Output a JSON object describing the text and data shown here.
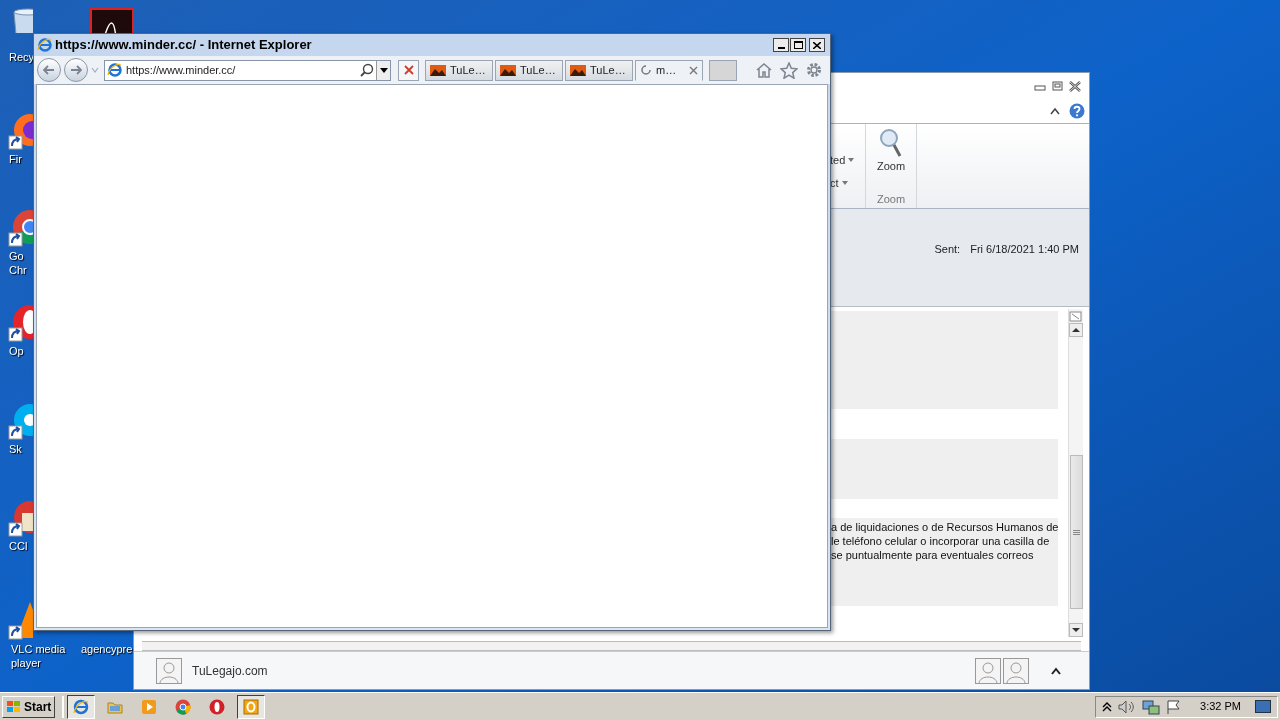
{
  "desktop_icons": [
    {
      "kind": "recycle",
      "lines": [
        "Recy"
      ]
    },
    {
      "kind": "pdf"
    },
    {
      "kind": "firefox",
      "lines": [
        "Fir"
      ]
    },
    {
      "kind": "chrome",
      "lines": [
        "Go",
        "Chr"
      ]
    },
    {
      "kind": "opera",
      "lines": [
        "Op"
      ]
    },
    {
      "kind": "skype",
      "lines": [
        "Sk"
      ]
    },
    {
      "kind": "ccleaner",
      "lines": [
        "CCl"
      ]
    },
    {
      "kind": "vlc",
      "lines": [
        "VLC media",
        "player"
      ]
    },
    {
      "kind": "file",
      "lines": [
        "agencypre"
      ]
    }
  ],
  "ie_window": {
    "title": "https://www.minder.cc/ - Internet Explorer",
    "address": "https://www.minder.cc/",
    "tabs": [
      {
        "label": "TuLe…",
        "selected": false,
        "loading": false
      },
      {
        "label": "TuLe…",
        "selected": false,
        "loading": false
      },
      {
        "label": "TuLe…",
        "selected": false,
        "loading": false
      },
      {
        "label": "m…",
        "selected": true,
        "loading": true
      }
    ]
  },
  "outlook_window": {
    "ribbon": {
      "partial_items": [
        "ted",
        "ct"
      ],
      "zoom_button": "Zoom",
      "group_label": "Zoom"
    },
    "sent_label": "Sent:",
    "sent_value": "Fri 6/18/2021 1:40 PM",
    "message_lines": [
      "a de liquidaciones o de Recursos Humanos de",
      "le teléfono celular o incorporar una casilla de",
      "se puntualmente para eventuales correos"
    ],
    "people_pane": {
      "name": "TuLegajo.com"
    }
  },
  "taskbar": {
    "start": "Start",
    "items": [
      {
        "kind": "ie",
        "active": true
      },
      {
        "kind": "explorer",
        "active": false
      },
      {
        "kind": "media",
        "active": false
      },
      {
        "kind": "chrome",
        "active": false
      },
      {
        "kind": "opera",
        "active": false
      },
      {
        "kind": "outlook",
        "active": true
      }
    ],
    "clock": "3:32 PM"
  }
}
